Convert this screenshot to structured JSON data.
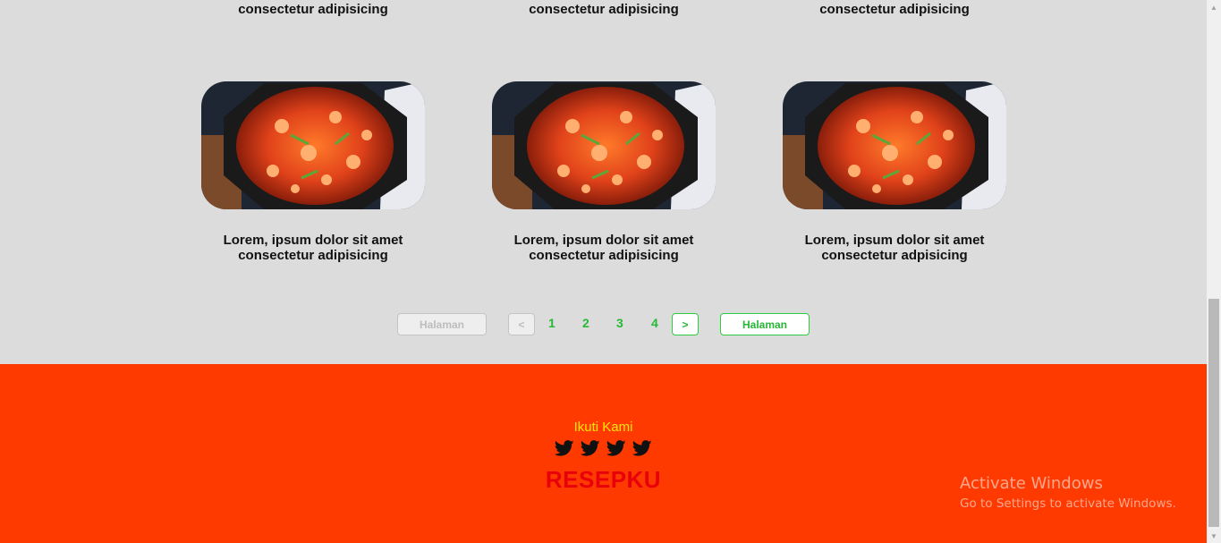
{
  "previous_row": {
    "captions": [
      "consectetur adipisicing",
      "consectetur adipisicing",
      "consectetur adipisicing"
    ]
  },
  "cards": [
    {
      "line1": "Lorem, ipsum dolor sit amet",
      "line2": "consectetur adipisicing"
    },
    {
      "line1": "Lorem, ipsum dolor sit amet",
      "line2": "consectetur adipisicing"
    },
    {
      "line1": "Lorem, ipsum dolor sit amet",
      "line2": "consectetur adpisicing"
    }
  ],
  "pagination": {
    "prev_page_label": "Halaman",
    "prev_arrow": "<",
    "pages": [
      "1",
      "2",
      "3",
      "4"
    ],
    "next_arrow": ">",
    "next_page_label": "Halaman"
  },
  "footer": {
    "follow_label": "Ikuti Kami",
    "social_icons": [
      "twitter-icon",
      "twitter-icon",
      "twitter-icon",
      "twitter-icon"
    ],
    "brand": "RESEPKU"
  },
  "watermark": {
    "title": "Activate Windows",
    "subtitle": "Go to Settings to activate Windows."
  },
  "colors": {
    "background": "#dcdcdc",
    "footer": "#ff3a00",
    "accent_green": "#27b836",
    "follow_text": "#ffe600",
    "brand_text": "#e8000b"
  }
}
